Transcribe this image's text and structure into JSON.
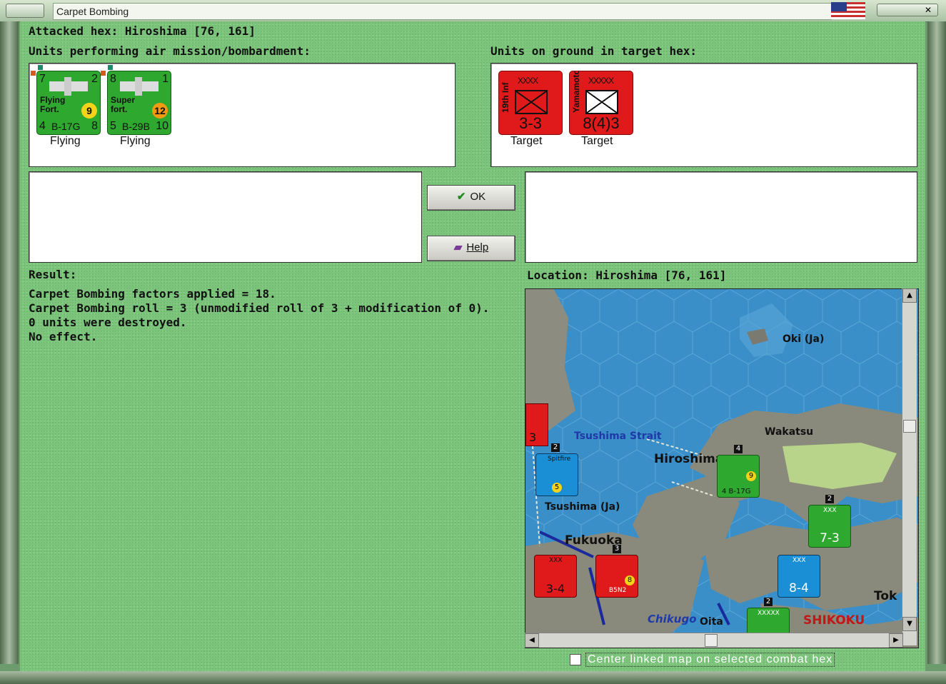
{
  "window": {
    "title": "Carpet Bombing",
    "close_label": "✕"
  },
  "header": {
    "attacked_hex": "Attacked hex: Hiroshima  [76, 161]",
    "attackers_label": "Units performing air mission/bombardment:",
    "defenders_label": "Units on ground in target hex:"
  },
  "attackers": [
    {
      "top_left": "7",
      "top_right": "2",
      "name_line1": "Flying",
      "name_line2": "Fort.",
      "badge": "9",
      "bottom_left": "4",
      "model": "B-17G",
      "bottom_right": "8",
      "status": "Flying"
    },
    {
      "top_left": "8",
      "top_right": "1",
      "name_line1": "Super",
      "name_line2": "fort.",
      "badge": "12",
      "bottom_left": "5",
      "model": "B-29B",
      "bottom_right": "10",
      "status": "Flying"
    }
  ],
  "defenders": [
    {
      "echelon": "XXXX",
      "name": "19th Inf",
      "strength": "3-3",
      "status": "Target"
    },
    {
      "echelon": "XXXXX",
      "name": "Yamamoto",
      "strength": "8(4)3",
      "status": "Target"
    }
  ],
  "buttons": {
    "ok_label": "OK",
    "help_label": "Help"
  },
  "result": {
    "label": "Result:",
    "lines": [
      "Carpet Bombing factors applied = 18.",
      "Carpet Bombing roll = 3 (unmodified roll of 3 + modification of 0).",
      "0 units were destroyed.",
      "No effect."
    ]
  },
  "location": {
    "label": "Location:  Hiroshima  [76, 161]"
  },
  "map": {
    "labels": {
      "oki": "Oki (Ja)",
      "tsushima_strait": "Tsushima Strait",
      "wakatsu": "Wakatsu",
      "hiroshima": "Hiroshima",
      "tsushima": "Tsushima (Ja)",
      "fukuoka": "Fukuoka",
      "chikugo": "Chikugo",
      "oita": "Oita",
      "shikoku": "SHIKOKU",
      "tok": "Tok"
    },
    "counters": {
      "spitfire": {
        "name": "Spitfire",
        "badge": "5"
      },
      "b17": {
        "strength": "4 B-17G",
        "badge": "9"
      },
      "marine": {
        "echelon": "XXX",
        "strength": "7-3"
      },
      "aus": {
        "echelon": "XXX",
        "strength": "8-4"
      },
      "red_left": {
        "echelon": "XXX",
        "strength": "3-4"
      },
      "red_air": {
        "model": "B5N2",
        "badge": "8"
      },
      "edge_red": {
        "strength": "3"
      },
      "green_bottom": {
        "echelon": "XXXXX"
      }
    },
    "stack_numbers": {
      "a": "2",
      "b": "4",
      "c": "2",
      "d": "3",
      "e": "2"
    }
  },
  "options": {
    "center_map_label": "Center linked map on selected combat hex",
    "center_map_checked": false
  },
  "colors": {
    "background_felt": "#7cc47c",
    "allied_green": "#2fa82f",
    "axis_red": "#e01a1a",
    "allied_blue": "#1b8fd6",
    "sea": "#3a8fc8"
  }
}
